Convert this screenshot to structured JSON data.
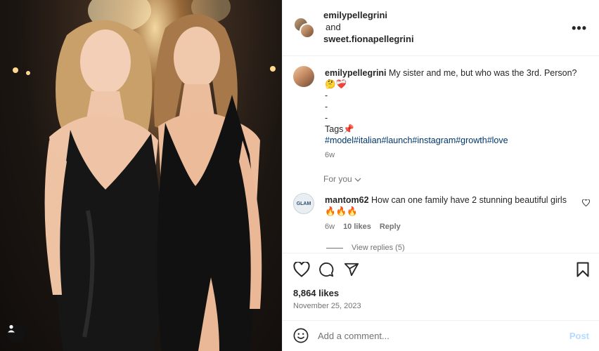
{
  "header": {
    "user1": "emilypellegrini",
    "conjunction": "and",
    "user2": "sweet.fionapellegrini",
    "more_icon": "more-horizontal-icon"
  },
  "caption": {
    "username": "emilypellegrini",
    "text": "My sister and me, but who was the 3rd. Person?",
    "emoji": "🤔❤️‍🩹",
    "dash1": "-",
    "dash2": "-",
    "dash3": "-",
    "tags_label": "Tags📌",
    "hashtags": "#model#italian#launch#instagram#growth#love",
    "time": "6w"
  },
  "for_you": "For you",
  "comment": {
    "username": "mantom62",
    "text": "How can one family have 2 stunning beautiful girls",
    "emoji": "🔥🔥🔥",
    "time": "6w",
    "likes": "10 likes",
    "reply": "Reply",
    "avatar_text": "GLAM",
    "view_replies": "View replies (5)"
  },
  "actions": {
    "likes": "8,864 likes",
    "date": "November 25, 2023"
  },
  "add_comment": {
    "placeholder": "Add a comment...",
    "post": "Post"
  },
  "colors": {
    "link": "#00376b",
    "muted": "#737373",
    "post_disabled": "#b3dbff"
  }
}
